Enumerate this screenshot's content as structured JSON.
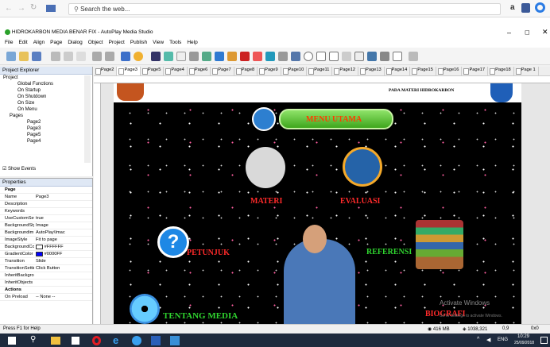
{
  "browser": {
    "search_placeholder": "Search the web..."
  },
  "window": {
    "title": "HIDROKARBON MEDIA BENAR FIX - AutoPlay Media Studio"
  },
  "menu": [
    "File",
    "Edit",
    "Align",
    "Page",
    "Dialog",
    "Object",
    "Project",
    "Publish",
    "View",
    "Tools",
    "Help"
  ],
  "project_explorer": {
    "title": "Project Explorer",
    "items": [
      "Project",
      "Global Functions",
      "On Startup",
      "On Shutdown",
      "On Size",
      "On Menu",
      "Pages",
      "Page2",
      "Page3",
      "Page5",
      "Page4"
    ],
    "show_events": "Show Events"
  },
  "properties": {
    "title": "Properties",
    "section_page": "Page",
    "rows": [
      [
        "Name",
        "Page3"
      ],
      [
        "Description",
        ""
      ],
      [
        "Keywords",
        ""
      ],
      [
        "UseCustomSett",
        "true"
      ],
      [
        "BackgroundStyl",
        "Image"
      ],
      [
        "Backgroundim",
        "AutoPlay\\Imac"
      ],
      [
        "ImageStyle",
        "Fit to page"
      ],
      [
        "BackgroundCol",
        "#FFFFFF"
      ],
      [
        "GradientColor",
        "#0000FF"
      ],
      [
        "Transition",
        "Slide"
      ],
      [
        "TransitionSettin",
        "Click Button"
      ],
      [
        "InheritBackgrou",
        ""
      ],
      [
        "InheritObjects",
        ""
      ]
    ],
    "section_actions": "Actions",
    "on_preload": "On Preload",
    "on_preload_value": "-- None --"
  },
  "tabs": [
    "Page2",
    "Page3",
    "Page5",
    "Page4",
    "Page6",
    "Page7",
    "Page8",
    "Page9",
    "Page10",
    "Page11",
    "Page12",
    "Page13",
    "Page14",
    "Page15",
    "Page16",
    "Page17",
    "Page18",
    "Page 1"
  ],
  "slide": {
    "header": "PADA MATERI HIDROKARBON",
    "menu_utama": "MENU UTAMA",
    "materi": "MATERI",
    "evaluasi": "EVALUASI",
    "petunjuk": "PETUNJUK",
    "referensi": "REFERENSI",
    "tentang_media": "TENTANG MEDIA",
    "biografi": "BIOGRAFI",
    "watermark1": "Activate Windows",
    "watermark2": "Go to Settings to activate Windows."
  },
  "status": {
    "help": "Press F1 for Help",
    "memory": "416 MB",
    "disk": "1038,321",
    "zoom": "0,9",
    "coords": "0x0"
  },
  "taskbar": {
    "lang": "ENG",
    "time": "10:29",
    "date": "25/09/2018"
  }
}
